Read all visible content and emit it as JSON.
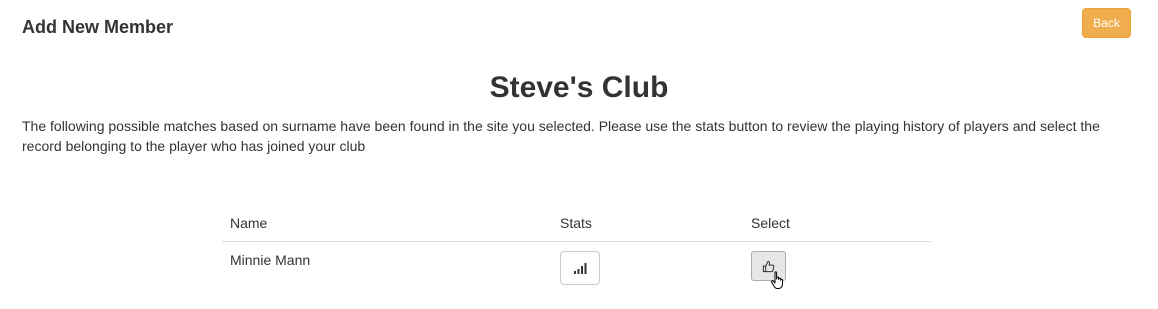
{
  "header": {
    "title": "Add New Member",
    "back_label": "Back",
    "back_color": "#f0ad4e"
  },
  "club": {
    "name": "Steve's Club"
  },
  "instructions": "The following possible matches based on surname have been found in the site you selected. Please use the stats button to review the playing history of players and select the record belonging to the player who has joined your club",
  "table": {
    "columns": [
      "Name",
      "Stats",
      "Select"
    ],
    "rows": [
      {
        "name": "Minnie Mann",
        "stats_icon": "bar-chart-icon",
        "select_icon": "thumbs-up-icon"
      }
    ]
  }
}
